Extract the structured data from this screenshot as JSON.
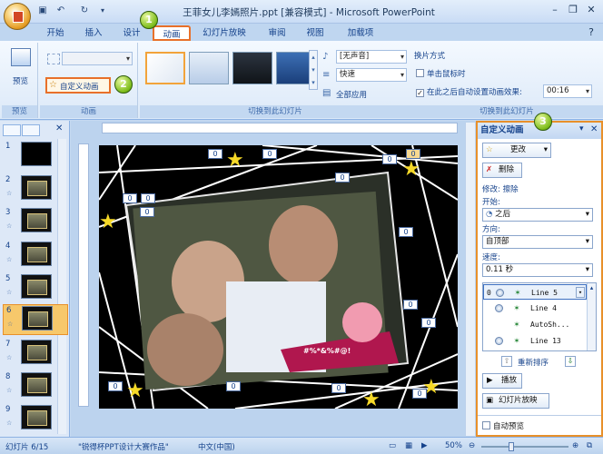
{
  "window": {
    "title": "王菲女儿李嫣照片.ppt [兼容模式] - Microsoft PowerPoint",
    "quick_access": [
      "save-icon",
      "undo-icon",
      "redo-icon"
    ]
  },
  "tabs": [
    {
      "label": "开始"
    },
    {
      "label": "插入"
    },
    {
      "label": "设计"
    },
    {
      "label": "动画",
      "active": true
    },
    {
      "label": "幻灯片放映"
    },
    {
      "label": "审阅"
    },
    {
      "label": "视图"
    },
    {
      "label": "加载项"
    }
  ],
  "ribbon": {
    "preview": {
      "label": "预览",
      "group": "预览"
    },
    "animation": {
      "custom_anim": "自定义动画",
      "group": "动画"
    },
    "transition": {
      "sound": "[无声音]",
      "speed": "快速",
      "apply_all": "全部应用",
      "group": "切换到此幻灯片",
      "advance_title": "换片方式",
      "on_click": "单击鼠标时",
      "after_time": "在此之后自动设置动画效果:",
      "time_value": "00:16"
    }
  },
  "callouts": [
    "1",
    "2",
    "3"
  ],
  "slides": [
    {
      "num": "1"
    },
    {
      "num": "2"
    },
    {
      "num": "3"
    },
    {
      "num": "4"
    },
    {
      "num": "5"
    },
    {
      "num": "6",
      "selected": true
    },
    {
      "num": "7"
    },
    {
      "num": "8"
    },
    {
      "num": "9"
    }
  ],
  "slide_badges": [
    "0",
    "0",
    "0",
    "0",
    "0",
    "0",
    "0",
    "0",
    "0",
    "0",
    "0",
    "0",
    "0",
    "0",
    "0"
  ],
  "slide_caption": "#%*&%#@!",
  "task_pane": {
    "title": "自定义动画",
    "change": "更改",
    "delete": "删除",
    "modify_label": "修改: 擦除",
    "start_label": "开始:",
    "start_value": "之后",
    "direction_label": "方向:",
    "direction_value": "自顶部",
    "speed_label": "速度:",
    "speed_value": "0.11 秒",
    "items": [
      {
        "order": "0",
        "name": "Line 5",
        "selected": true
      },
      {
        "order": "",
        "name": "Line 4"
      },
      {
        "order": "",
        "name": "AutoSh..."
      },
      {
        "order": "",
        "name": "Line 13"
      }
    ],
    "reorder": "重新排序",
    "play": "播放",
    "slideshow": "幻灯片放映",
    "autopreview": "自动预览"
  },
  "status": {
    "slide_info": "幻灯片 6/15",
    "theme": "\"锐得杯PPT设计大赛作品\"",
    "language": "中文(中国)",
    "zoom": "50%"
  }
}
